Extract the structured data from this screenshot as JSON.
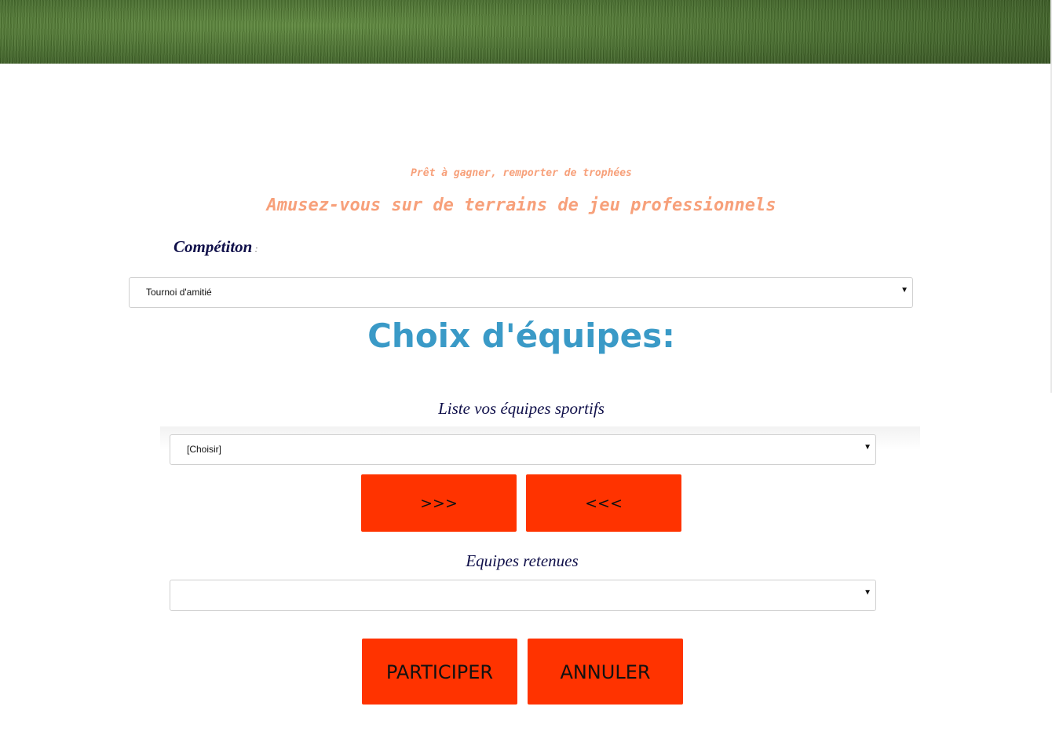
{
  "hero": {
    "tagline": "Prêt à gagner, remporter de trophées",
    "headline": "Amusez-vous sur de terrains de jeu professionnels"
  },
  "competition": {
    "label": "Compétiton",
    "colon": ":",
    "selected": "Tournoi d'amitié"
  },
  "teams": {
    "title": "Choix d'équipes:",
    "list_label": "Liste vos équipes sportifs",
    "list_selected": "[Choisir]",
    "add_label": ">>>",
    "remove_label": "<<<",
    "retained_label": "Equipes retenues",
    "retained_selected": ""
  },
  "actions": {
    "participate_label": "PARTICIPER",
    "cancel_label": "ANNULER"
  },
  "colors": {
    "accent_button": "#ff3300",
    "title_blue": "#3a9ac7",
    "tagline_orange": "#f7a07a",
    "label_navy": "#10104a"
  },
  "icons": {
    "dropdown": "caret-down-icon"
  }
}
